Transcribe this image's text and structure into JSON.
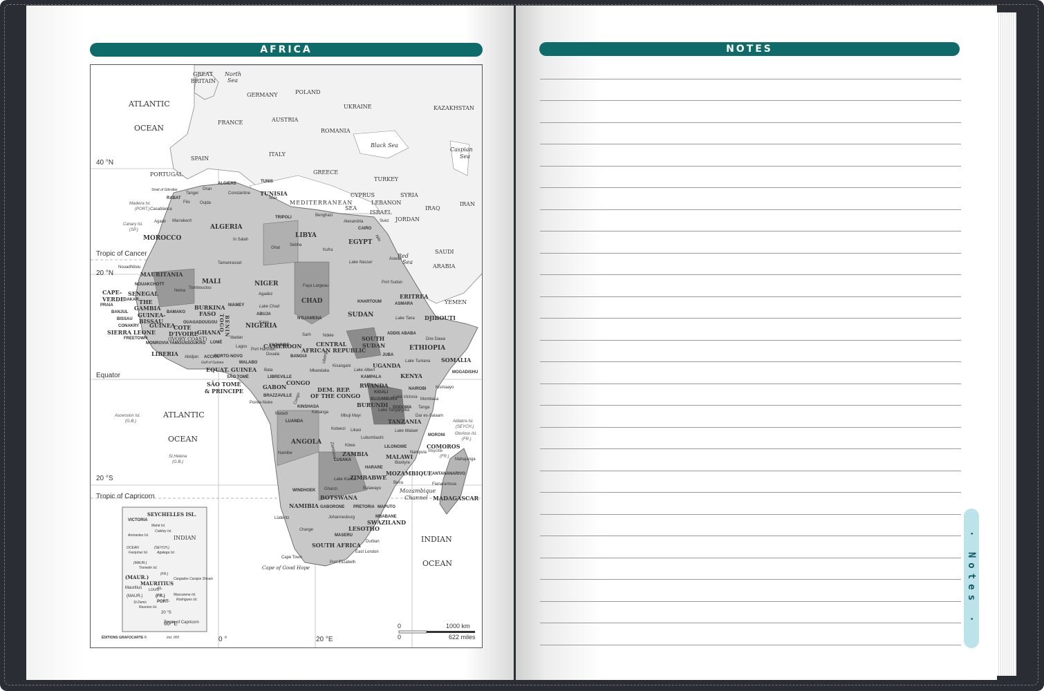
{
  "left_page": {
    "title": "AFRICA",
    "map": {
      "oceans": [
        "ATLANTIC",
        "OCEAN",
        "ATLANTIC",
        "OCEAN",
        "INDIAN",
        "OCEAN"
      ],
      "seas": [
        "MEDITERRANEAN",
        "SEA",
        "Black Sea",
        "Red",
        "Sea",
        "Caspian",
        "Sea",
        "North",
        "Sea",
        "Mozambique",
        "Channel"
      ],
      "latitudes": [
        "40 °N",
        "Tropic of Cancer",
        "20 °N",
        "Equator",
        "20 °S",
        "Tropic of Capricorn"
      ],
      "longitudes": [
        "0 °",
        "20 °E",
        "60 °E"
      ],
      "europe_asia": [
        "GREAT",
        "BRITAIN",
        "GERMANY",
        "POLAND",
        "UKRAINE",
        "KAZAKHSTAN",
        "FRANCE",
        "AUSTRIA",
        "ROMANIA",
        "ITALY",
        "SPAIN",
        "PORTUGAL",
        "GREECE",
        "TURKEY",
        "CYPRUS",
        "LEBANON",
        "SYRIA",
        "ISRAEL",
        "JORDAN",
        "IRAQ",
        "IRAN",
        "SAUDI",
        "ARABIA",
        "YEMEN"
      ],
      "countries": [
        "MOROCCO",
        "ALGERIA",
        "TUNISIA",
        "LIBYA",
        "EGYPT",
        "MAURITANIA",
        "MALI",
        "NIGER",
        "CHAD",
        "SUDAN",
        "ERITREA",
        "DJIBOUTI",
        "ETHIOPIA",
        "SOMALIA",
        "SENEGAL",
        "THE",
        "GAMBIA",
        "GUINEA-",
        "BISSAU",
        "GUINEA",
        "SIERRA LEONE",
        "LIBERIA",
        "COTE",
        "D'IVOIRE",
        "(IVORY COAST)",
        "BURKINA",
        "FASO",
        "GHANA",
        "TOGO",
        "BENIN",
        "NIGERIA",
        "CAMEROON",
        "CENTRAL",
        "AFRICAN REPUBLIC",
        "SOUTH",
        "SUDAN",
        "UGANDA",
        "KENYA",
        "EQUAT. GUINEA",
        "GABON",
        "CONGO",
        "DEM. REP.",
        "OF THE CONGO",
        "RWANDA",
        "BURUNDI",
        "TANZANIA",
        "ANGOLA",
        "ZAMBIA",
        "MALAWI",
        "MOZAMBIQUE",
        "ZIMBABWE",
        "NAMIBIA",
        "BOTSWANA",
        "SOUTH AFRICA",
        "LESOTHO",
        "SWAZILAND",
        "MADAGASCAR",
        "COMOROS",
        "CAPE-",
        "VERDE",
        "SÃO TOMÉ",
        "& PRINCIPE"
      ],
      "cities": [
        "RABAT",
        "ALGIERS",
        "TUNIS",
        "TRIPOLI",
        "CAIRO",
        "NOUAKCHOTT",
        "DAKAR",
        "BAMAKO",
        "NIAMEY",
        "N'DJAMENA",
        "KHARTOUM",
        "ASMARA",
        "ADDIS ABABA",
        "ABUJA",
        "YAOUNDE",
        "BANGUI",
        "JUBA",
        "KAMPALA",
        "NAIROBI",
        "LIBREVILLE",
        "BRAZZAVILLE",
        "KINSHASA",
        "LUANDA",
        "KIGALI",
        "BUJUMBURA",
        "DODOMA",
        "LUSAKA",
        "LILONGWE",
        "HARARE",
        "WINDHOEK",
        "GABORONE",
        "PRETORIA",
        "MAPUTO",
        "MBABANE",
        "MASERU",
        "ANTANANARIVO",
        "MOGADISHU",
        "MORONI",
        "ACCRA",
        "LOMÉ",
        "PORTO-NOVO",
        "MONROVIA",
        "FREETOWN",
        "CONAKRY",
        "BISSAU",
        "BANJUL",
        "PRAIA",
        "YAMOUSSOUKRO",
        "OUAGADOUGOU",
        "MALABO",
        "SÃO TOMÉ"
      ],
      "small_places": [
        "Casablanca",
        "Marrakech",
        "Oran",
        "Constantine",
        "Benghazi",
        "Alexandria",
        "Suez",
        "Aswan",
        "Tamanrasset",
        "In Salah",
        "Sebha",
        "Ghat",
        "Kufra",
        "Tombouctou",
        "Agadez",
        "Faya Largeau",
        "Port Sudan",
        "Lake Chad",
        "Lake Nasser",
        "Lake Tana",
        "Lake Turkana",
        "Lake Victoria",
        "Lake Albert",
        "Lake Tanganyika",
        "Lake Malawi",
        "Lake Kariba",
        "Dire Dawa",
        "Kismaayo",
        "Mombasa",
        "Tanga",
        "Dar es-Salaam",
        "Kisangani",
        "Mbandaka",
        "Pointe-Noire",
        "Matadi",
        "Kananga",
        "Lubumbashi",
        "Likasi",
        "Kolwezi",
        "Mbuji Mayi",
        "Kitwe",
        "Nampula",
        "Blantyre",
        "Beira",
        "Bulawayo",
        "Ghanzi",
        "Johannesburg",
        "Durban",
        "East London",
        "Port Elizabeth",
        "Cape Town",
        "Cape of Good Hope",
        "Lüderitz",
        "Namibe",
        "Abidjan",
        "Ibadan",
        "Lagos",
        "Port Harcourt",
        "Douala",
        "Bata",
        "Sarh",
        "Ndele",
        "Fianarantsoa",
        "Mahajanga",
        "Kano",
        "Nema",
        "Nouadhibou",
        "Agadir",
        "Fès",
        "Oujda",
        "Tanger",
        "Sfax"
      ],
      "islands": [
        "Madeira Isl.",
        "(PORT.)",
        "Canary Isl.",
        "(SP.)",
        "Ascension Isl.",
        "(G.B.)",
        "St.Helena",
        "(G.B.)",
        "Aldabra Isl.",
        "(SEYCH.)",
        "Glorioso Isl.",
        "(FR.)",
        "Mayotte",
        "(FR.)"
      ],
      "inset": [
        "SEYCHELLES ISL.",
        "VICTORIA",
        "Mahé Isl.",
        "Coëtivy Isl.",
        "Amirantes Isl.",
        "INDIAN",
        "OCEAN",
        "Farquhar Isl.",
        "(SEYCH.)",
        "Agalega Isl.",
        "(MAUR.)",
        "Tromelin Isl.",
        "(FR.)",
        "Cargados Carajos Shoals",
        "(MAUR.)",
        "MAURITIUS",
        "ISL.",
        "Mascarene Isl.",
        "Rodrigues Isl.",
        "(MAUR.)",
        "St.Denis",
        "Reunion Isl.",
        "(FR.)",
        "PORT-",
        "LOUIS",
        "Mauritius",
        "20 °S",
        "Tropic of Capricorn",
        "60 °E"
      ],
      "straits": [
        "Strait of Gibraltar",
        "Gulf of Guinea",
        "Nile",
        "Congo",
        "Zambèze",
        "Orange",
        "Ubangi"
      ],
      "scale": {
        "top_left": "0",
        "top_right": "1000 km",
        "bottom_left": "0",
        "bottom_right": "622 miles"
      },
      "credit": "ÉDITIONS GRAFOCARTE ©",
      "code": "Ind. 005"
    }
  },
  "right_page": {
    "title": "NOTES",
    "line_count": 27,
    "tab_label": "· Notes ·"
  },
  "colors": {
    "header": "#0e6b69",
    "tab": "#bde3ea",
    "cover": "#2a2d33"
  }
}
